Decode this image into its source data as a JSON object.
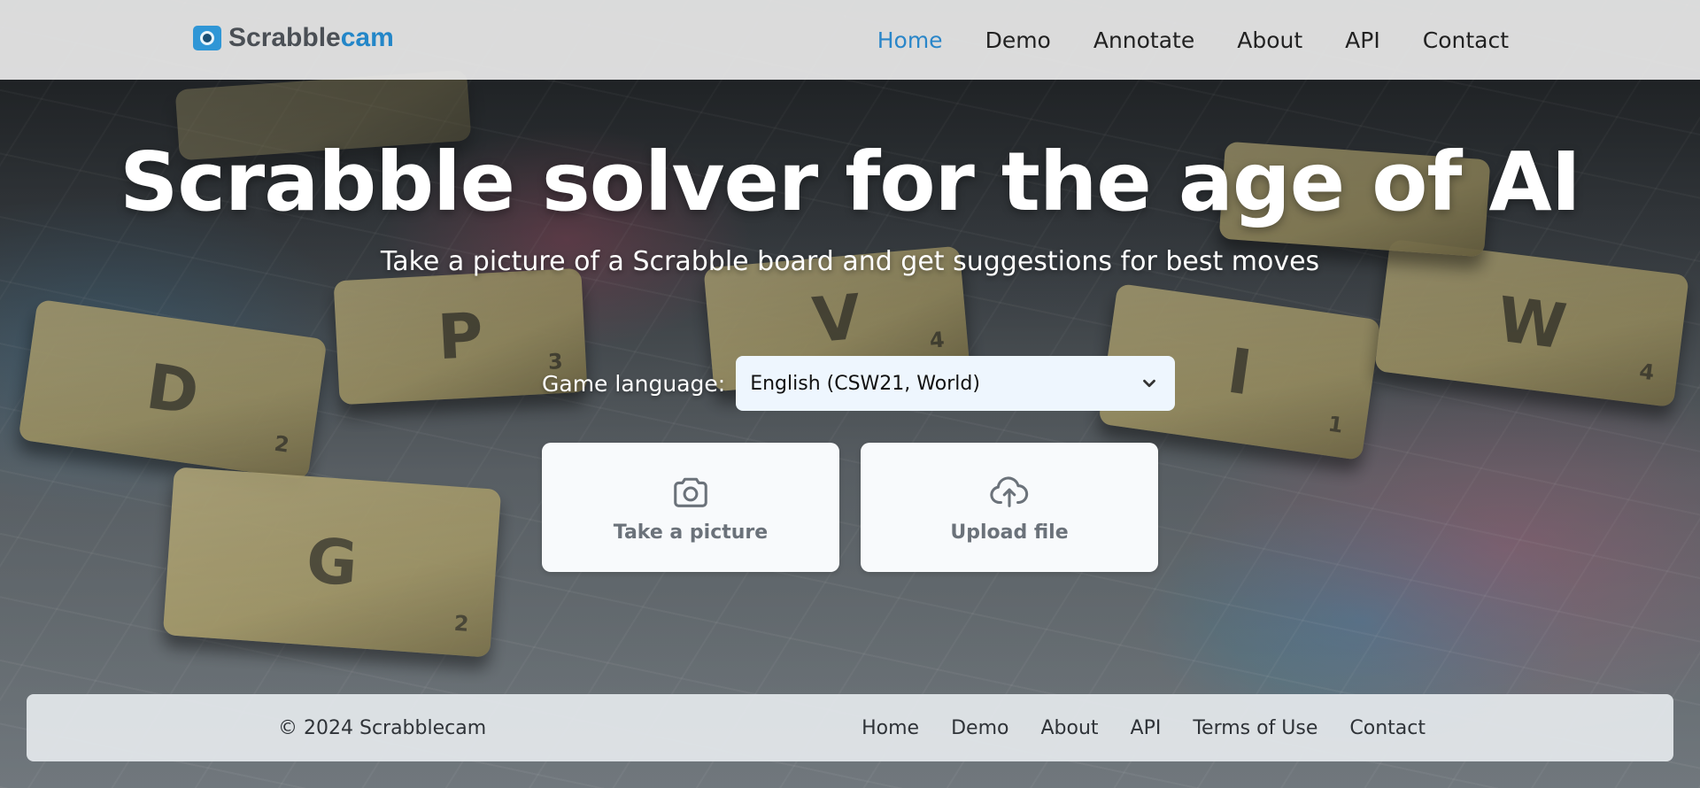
{
  "header": {
    "brand": {
      "part1": "Scrabble",
      "part2": "cam",
      "icon": "camera-icon"
    },
    "nav": [
      {
        "label": "Home",
        "active": true
      },
      {
        "label": "Demo",
        "active": false
      },
      {
        "label": "Annotate",
        "active": false
      },
      {
        "label": "About",
        "active": false
      },
      {
        "label": "API",
        "active": false
      },
      {
        "label": "Contact",
        "active": false
      }
    ]
  },
  "hero": {
    "title": "Scrabble solver for the age of AI",
    "subtitle": "Take a picture of a Scrabble board and get suggestions for best moves"
  },
  "language": {
    "label": "Game language:",
    "selected": "English (CSW21, World)",
    "icon": "chevron-down-icon"
  },
  "actions": [
    {
      "label": "Take a picture",
      "icon": "camera-icon"
    },
    {
      "label": "Upload file",
      "icon": "cloud-upload-icon"
    }
  ],
  "footer": {
    "copyright": "© 2024 Scrabblecam",
    "links": [
      "Home",
      "Demo",
      "About",
      "API",
      "Terms of Use",
      "Contact"
    ]
  },
  "colors": {
    "accent": "#2a86c9",
    "navbar_bg": "#ececec",
    "card_bg": "#f8fafc",
    "select_bg": "#eef6fe"
  }
}
